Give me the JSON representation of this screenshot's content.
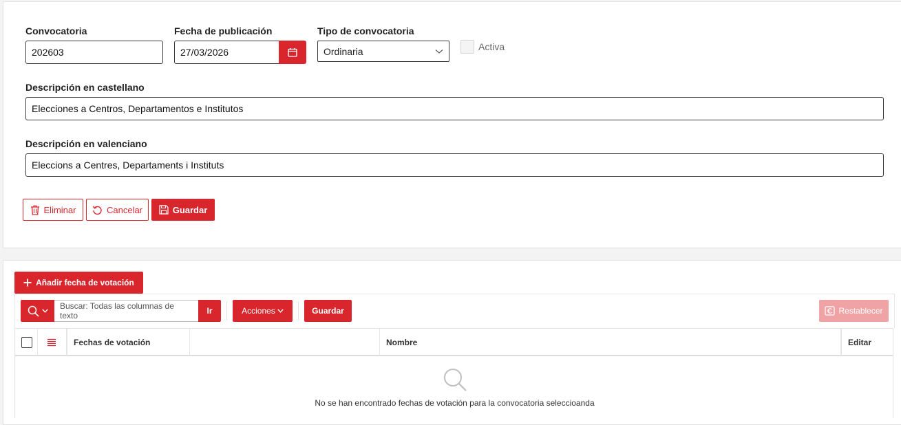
{
  "form": {
    "convocatoria_label": "Convocatoria",
    "convocatoria_value": "202603",
    "fecha_label": "Fecha de publicación",
    "fecha_value": "27/03/2026",
    "tipo_label": "Tipo de convocatoria",
    "tipo_value": "Ordinaria",
    "activa_label": "Activa",
    "desc_cast_label": "Descripción en castellano",
    "desc_cast_value": "Elecciones a Centros, Departamentos e Institutos",
    "desc_val_label": "Descripción en valenciano",
    "desc_val_value": "Eleccions a Centres, Departaments i Instituts"
  },
  "form_actions": {
    "eliminar": "Eliminar",
    "cancelar": "Cancelar",
    "guardar": "Guardar"
  },
  "grid": {
    "add_button": "Añadir fecha de votación",
    "search_placeholder": "Buscar: Todas las columnas de texto",
    "go_button": "Ir",
    "actions_button": "Acciones",
    "save_button": "Guardar",
    "reset_button": "Restablecer",
    "columns": [
      "Fechas de votación",
      "",
      "Nombre",
      "Editar"
    ],
    "empty_message": "No se han encontrado fechas de votación para la convocatoria seleccioanda"
  },
  "colors": {
    "accent": "#d9262c",
    "accent_disabled": "#efa3a5"
  },
  "icons": {
    "calendar": "calendar-icon",
    "chevron": "chevron-down-icon",
    "trash": "trash-icon",
    "undo": "undo-icon",
    "save": "save-icon",
    "plus": "plus-icon",
    "search": "search-icon",
    "reset": "reset-icon",
    "menu": "hamburger-icon"
  }
}
